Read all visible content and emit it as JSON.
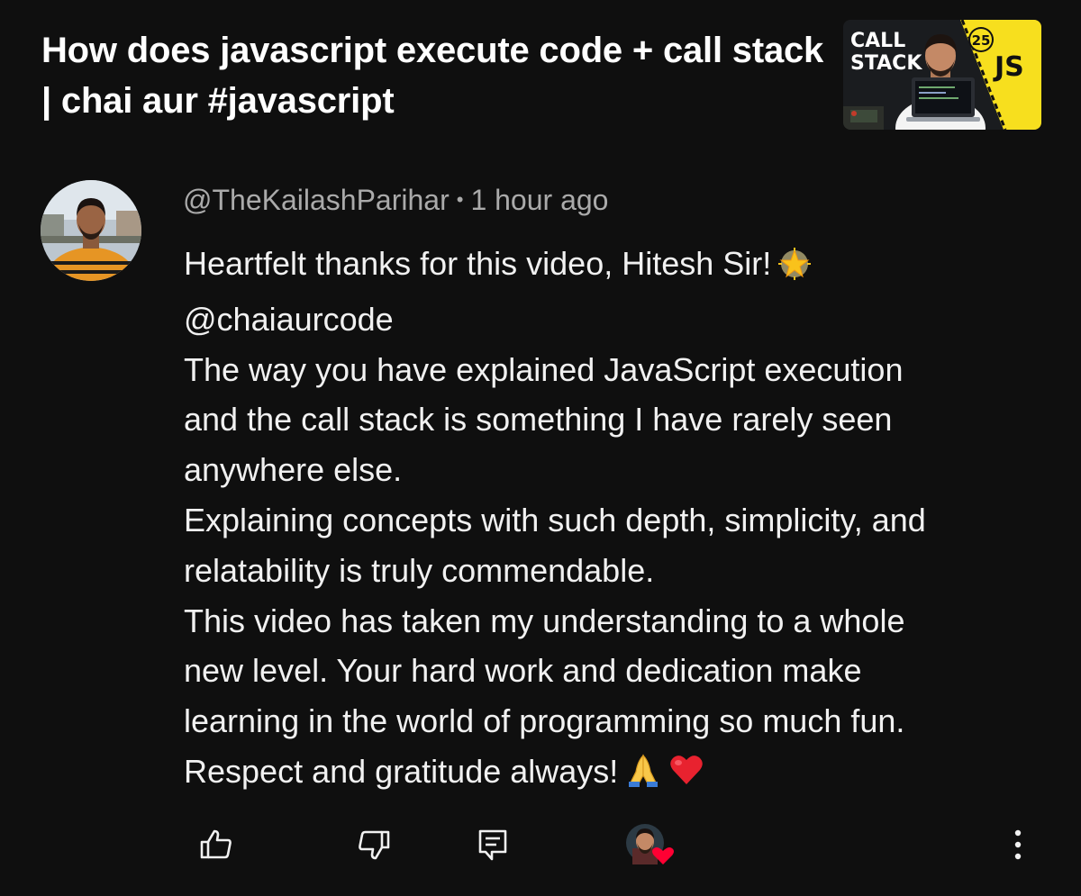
{
  "video": {
    "title": "How does javascript execute code + call stack | chai aur #javascript",
    "thumbnail": {
      "text_line1": "CALL",
      "text_line2": "STACK",
      "badge": "25",
      "js_label": "JS",
      "accent_color": "#f7df1e"
    }
  },
  "comment": {
    "author": "@TheKailashParihar",
    "separator": "•",
    "time": "1 hour ago",
    "lines": [
      "Heartfelt thanks for this video, Hitesh Sir!",
      "@chaiaurcode",
      "The way you have explained JavaScript execution",
      "and the call stack is something I have rarely seen",
      "anywhere else.",
      "Explaining concepts with such depth, simplicity, and",
      "relatability is truly commendable.",
      "This video has taken my understanding to a whole",
      "new level. Your hard work and dedication make",
      "learning in the world of programming so much fun.",
      "Respect and gratitude always!"
    ],
    "emojis": {
      "line1": "glowing-star-icon",
      "last_line": [
        "folded-hands-icon",
        "red-heart-icon"
      ]
    }
  },
  "actions": {
    "like_icon": "thumbs-up-icon",
    "dislike_icon": "thumbs-down-icon",
    "reply_icon": "reply-comment-icon",
    "creator_heart_icon": "creator-heart-icon",
    "more_icon": "more-vertical-icon"
  },
  "colors": {
    "background": "#0f0f0f",
    "text_primary": "#f1f1f1",
    "text_secondary": "#aaaaaa",
    "heart": "#ff0033"
  }
}
